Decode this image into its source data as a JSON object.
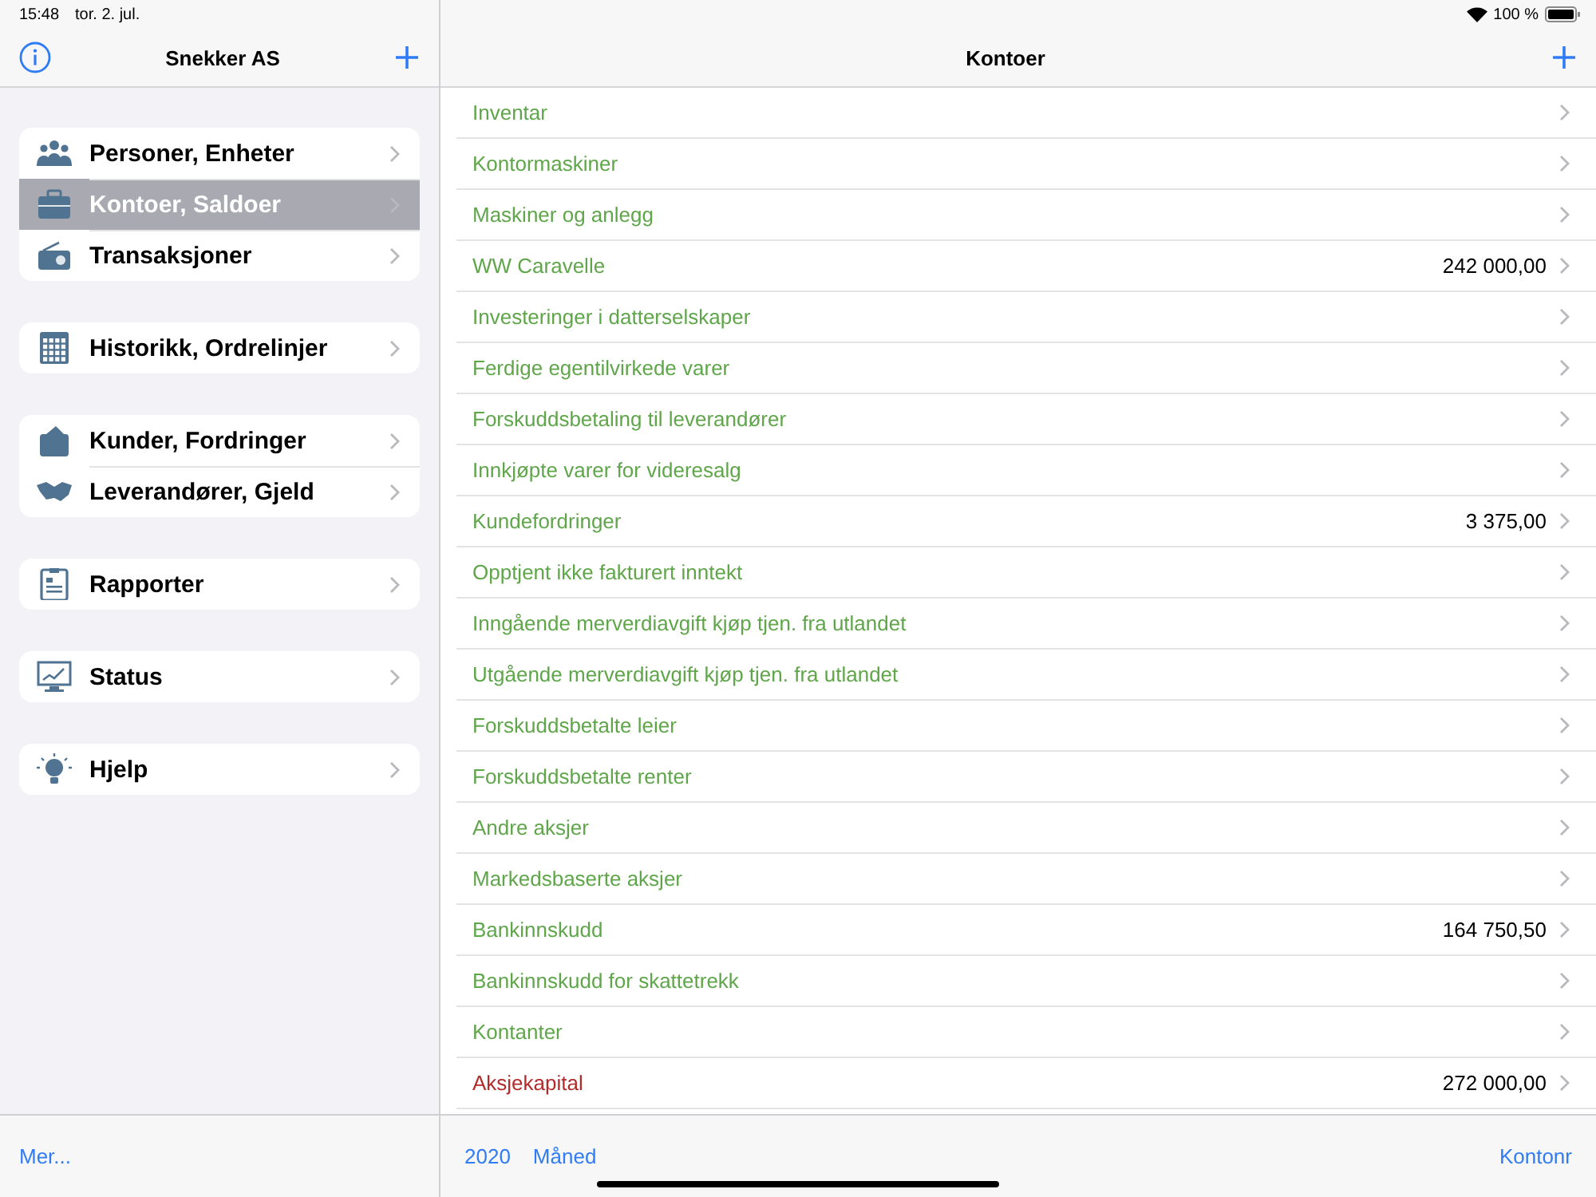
{
  "status_bar": {
    "time": "15:48",
    "date": "tor. 2. jul.",
    "battery": "100 %"
  },
  "sidebar": {
    "title": "Snekker AS",
    "groups": [
      {
        "items": [
          {
            "label": "Personer, Enheter",
            "selected": false
          },
          {
            "label": "Kontoer, Saldoer",
            "selected": true
          },
          {
            "label": "Transaksjoner",
            "selected": false
          }
        ]
      },
      {
        "items": [
          {
            "label": "Historikk, Ordrelinjer",
            "selected": false
          }
        ]
      },
      {
        "items": [
          {
            "label": "Kunder, Fordringer",
            "selected": false
          },
          {
            "label": "Leverandører, Gjeld",
            "selected": false
          }
        ]
      },
      {
        "items": [
          {
            "label": "Rapporter",
            "selected": false
          }
        ]
      },
      {
        "items": [
          {
            "label": "Status",
            "selected": false
          }
        ]
      },
      {
        "items": [
          {
            "label": "Hjelp",
            "selected": false
          }
        ]
      }
    ],
    "footer": "Mer..."
  },
  "main": {
    "title": "Kontoer",
    "accounts": [
      {
        "name": "Inventar",
        "color": "#5fa64a"
      },
      {
        "name": "Kontormaskiner",
        "color": "#5fa64a"
      },
      {
        "name": "Maskiner og anlegg",
        "color": "#5fa64a"
      },
      {
        "name": "WW Caravelle",
        "color": "#5fa64a",
        "balance": "242 000,00"
      },
      {
        "name": "Investeringer i datterselskaper",
        "color": "#5fa64a"
      },
      {
        "name": "Ferdige egentilvirkede varer",
        "color": "#5fa64a"
      },
      {
        "name": "Forskuddsbetaling til leverandører",
        "color": "#5fa64a"
      },
      {
        "name": "Innkjøpte varer for videresalg",
        "color": "#5fa64a"
      },
      {
        "name": "Kundefordringer",
        "color": "#5fa64a",
        "balance": "3 375,00"
      },
      {
        "name": "Opptjent ikke fakturert inntekt",
        "color": "#5fa64a"
      },
      {
        "name": "Inngående merverdiavgift kjøp tjen. fra utlandet",
        "color": "#5fa64a"
      },
      {
        "name": "Utgående merverdiavgift kjøp tjen. fra utlandet",
        "color": "#5fa64a"
      },
      {
        "name": "Forskuddsbetalte leier",
        "color": "#5fa64a"
      },
      {
        "name": "Forskuddsbetalte renter",
        "color": "#5fa64a"
      },
      {
        "name": "Andre aksjer",
        "color": "#5fa64a"
      },
      {
        "name": "Markedsbaserte aksjer",
        "color": "#5fa64a"
      },
      {
        "name": "Bankinnskudd",
        "color": "#5fa64a",
        "balance": "164 750,50"
      },
      {
        "name": "Bankinnskudd for skattetrekk",
        "color": "#5fa64a"
      },
      {
        "name": "Kontanter",
        "color": "#5fa64a"
      },
      {
        "name": "Aksjekapital",
        "color": "#b22a2a",
        "balance": "272 000,00"
      }
    ],
    "toolbar": {
      "year": "2020",
      "period": "Måned",
      "sort": "Kontonr"
    }
  }
}
